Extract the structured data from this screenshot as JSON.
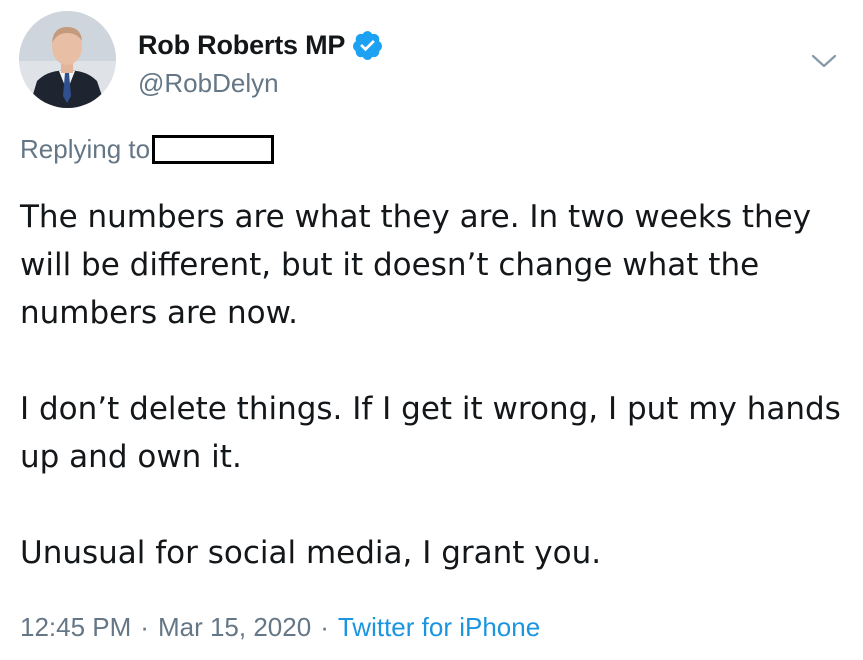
{
  "author": {
    "display_name": "Rob Roberts MP",
    "handle": "@RobDelyn",
    "verified": true,
    "avatar_icon": "profile-photo-man-in-suit"
  },
  "reply": {
    "prefix": "Replying to"
  },
  "tweet": {
    "paragraphs": [
      "The numbers are what they are. In two weeks they will be different, but it doesn’t change what the numbers are now.",
      "I don’t delete things. If I get it wrong, I put my hands up and own it.",
      "Unusual for social media, I grant you."
    ]
  },
  "meta": {
    "time": "12:45 PM",
    "date": "Mar 15, 2020",
    "source": "Twitter for iPhone",
    "separator": "·"
  },
  "colors": {
    "text": "#14171a",
    "secondary": "#657786",
    "link": "#1b95e0",
    "verified_badge": "#1da1f2"
  }
}
